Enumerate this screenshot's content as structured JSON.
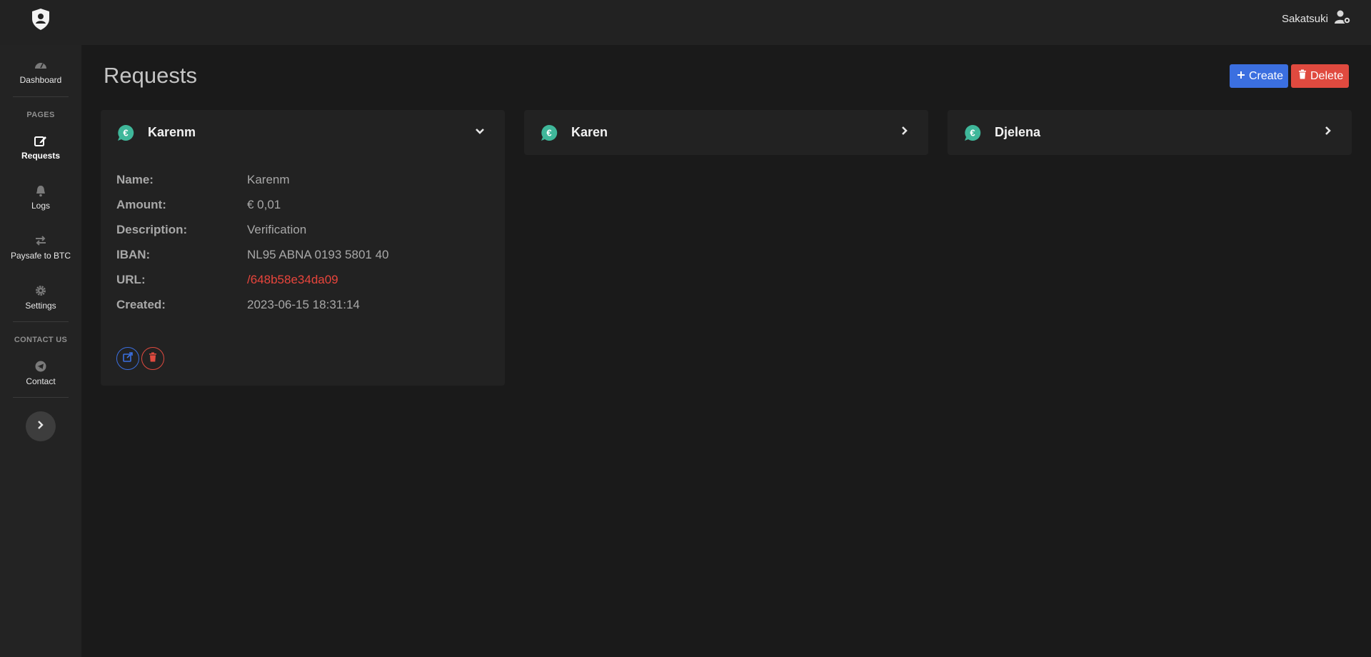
{
  "topbar": {
    "user_name": "Sakatsuki"
  },
  "sidebar": {
    "dashboard": "Dashboard",
    "pages_heading": "PAGES",
    "requests": "Requests",
    "logs": "Logs",
    "paysafe": "Paysafe to BTC",
    "settings": "Settings",
    "contact_heading": "CONTACT US",
    "contact": "Contact"
  },
  "main": {
    "title": "Requests",
    "create_label": "Create",
    "delete_label": "Delete"
  },
  "requests": [
    {
      "name": "Karenm",
      "expanded": true,
      "details": {
        "name_label": "Name:",
        "name": "Karenm",
        "amount_label": "Amount:",
        "amount": "€ 0,01",
        "description_label": "Description:",
        "description": "Verification",
        "iban_label": "IBAN:",
        "iban": "NL95 ABNA 0193 5801 40",
        "url_label": "URL:",
        "url": "/648b58e34da09",
        "created_label": "Created:",
        "created": "2023-06-15 18:31:14"
      }
    },
    {
      "name": "Karen",
      "expanded": false
    },
    {
      "name": "Djelena",
      "expanded": false
    }
  ],
  "colors": {
    "accent_blue": "#3b6fe0",
    "danger_red": "#e04a3f",
    "euro_teal": "#3fb79a"
  },
  "icons": {
    "logo": "shield-user-icon",
    "user": "user-gear-icon",
    "currency": "euro-icon"
  }
}
